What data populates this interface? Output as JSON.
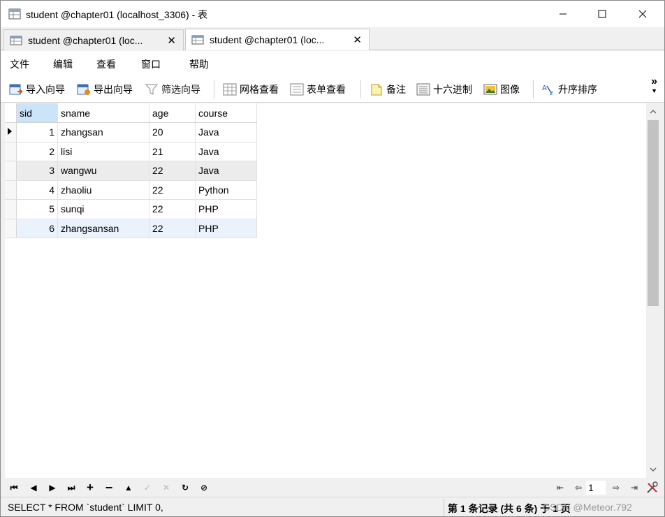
{
  "window": {
    "title": "student @chapter01 (localhost_3306) - 表",
    "minimize_icon": "minimize-icon",
    "maximize_icon": "maximize-icon",
    "close_icon": "close-icon"
  },
  "tabs": [
    {
      "label": "student @chapter01 (loc...",
      "close": "✕",
      "active": false
    },
    {
      "label": "student @chapter01 (loc...",
      "close": "✕",
      "active": true
    }
  ],
  "menu": [
    "文件",
    "编辑",
    "查看",
    "窗口",
    "帮助"
  ],
  "toolbar": {
    "import": "导入向导",
    "export": "导出向导",
    "filter": "筛选向导",
    "grid_view": "网格查看",
    "form_view": "表单查看",
    "memo": "备注",
    "hex": "十六进制",
    "image": "图像",
    "sort_asc": "升序排序",
    "more": "»"
  },
  "grid": {
    "columns": [
      "sid",
      "sname",
      "age",
      "course"
    ],
    "rows": [
      [
        "1",
        "zhangsan",
        "20",
        "Java"
      ],
      [
        "2",
        "lisi",
        "21",
        "Java"
      ],
      [
        "3",
        "wangwu",
        "22",
        "Java"
      ],
      [
        "4",
        "zhaoliu",
        "22",
        "Python"
      ],
      [
        "5",
        "sunqi",
        "22",
        "PHP"
      ],
      [
        "6",
        "zhangsansan",
        "22",
        "PHP"
      ]
    ],
    "current_row": 0,
    "hover_row": 2,
    "selected_row": 5
  },
  "navigation": {
    "page": "1"
  },
  "status": {
    "sql": "SELECT * FROM `student` LIMIT 0,",
    "record_info": "第 1 条记录 (共 6 条) 于 1 页",
    "watermark": "CSDN @Meteor.792"
  },
  "colors": {
    "header_highlight": "#cce4f7",
    "selected_row": "#eaf3fc",
    "hover_row": "#ececec"
  }
}
